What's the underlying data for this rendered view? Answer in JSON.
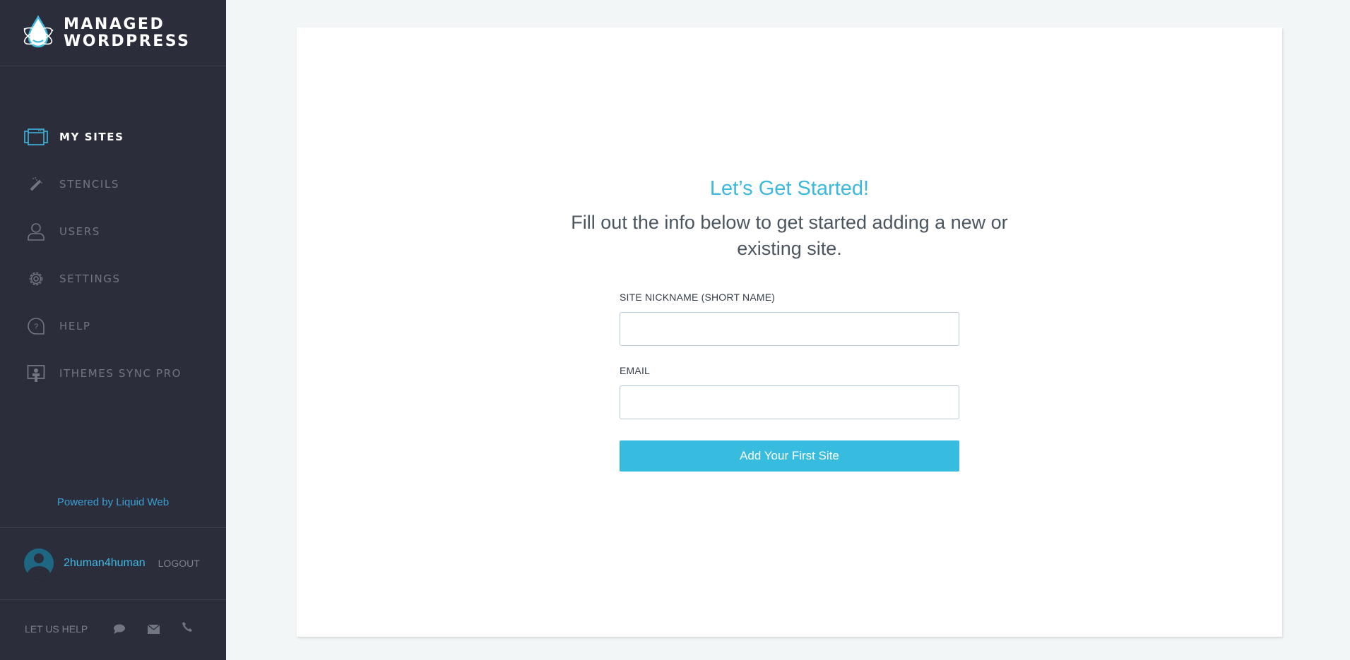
{
  "brand": {
    "line1": "MANAGED",
    "line2": "WORDPRESS",
    "accent": "#3db8df"
  },
  "nav": {
    "items": [
      {
        "label": "MY SITES",
        "icon": "sites-window-icon",
        "active": true
      },
      {
        "label": "STENCILS",
        "icon": "magic-wand-icon",
        "active": false
      },
      {
        "label": "USERS",
        "icon": "user-icon",
        "active": false
      },
      {
        "label": "SETTINGS",
        "icon": "gear-icon",
        "active": false
      },
      {
        "label": "HELP",
        "icon": "help-bubble-icon",
        "active": false
      },
      {
        "label": "ITHEMES SYNC PRO",
        "icon": "presenter-icon",
        "active": false
      }
    ]
  },
  "footer": {
    "powered_by": "Powered by Liquid Web",
    "username": "2human4human",
    "logout": "LOGOUT",
    "help_label": "LET US HELP",
    "help_icons": [
      "chat-icon",
      "email-icon",
      "phone-icon"
    ]
  },
  "main": {
    "title": "Let’s Get Started!",
    "subtitle": "Fill out the info below to get started adding a new or existing site.",
    "fields": [
      {
        "label": "SITE NICKNAME (SHORT NAME)",
        "value": "",
        "placeholder": ""
      },
      {
        "label": "EMAIL",
        "value": "",
        "placeholder": ""
      }
    ],
    "submit_label": "Add Your First Site"
  }
}
